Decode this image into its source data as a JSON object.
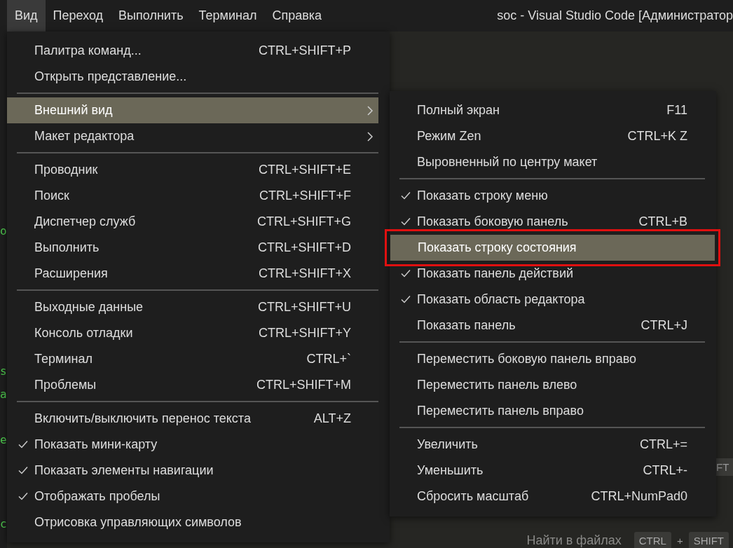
{
  "menubar": {
    "items": [
      {
        "label": "Вид",
        "selected": true
      },
      {
        "label": "Переход",
        "selected": false
      },
      {
        "label": "Выполнить",
        "selected": false
      },
      {
        "label": "Терминал",
        "selected": false
      },
      {
        "label": "Справка",
        "selected": false
      }
    ],
    "title": "soc - Visual Studio Code [Администратор"
  },
  "editor": {
    "code_fragments": [
      "o",
      "s",
      "a",
      "e",
      "c"
    ],
    "partial_key": "FT",
    "hint": {
      "label": "Найти в файлах",
      "keys": [
        {
          "kind": "key",
          "text": "CTRL"
        },
        {
          "kind": "plus",
          "text": "+"
        },
        {
          "kind": "key",
          "text": "SHIFT"
        }
      ]
    }
  },
  "view_menu": {
    "groups": [
      [
        {
          "label": "Палитра команд...",
          "shortcut": "CTRL+SHIFT+P",
          "checked": false,
          "selected": false,
          "submenu": false
        },
        {
          "label": "Открыть представление...",
          "checked": false,
          "selected": false,
          "submenu": false
        }
      ],
      [
        {
          "label": "Внешний вид",
          "checked": false,
          "selected": true,
          "submenu": true
        },
        {
          "label": "Макет редактора",
          "checked": false,
          "selected": false,
          "submenu": true
        }
      ],
      [
        {
          "label": "Проводник",
          "shortcut": "CTRL+SHIFT+E",
          "checked": false,
          "selected": false,
          "submenu": false
        },
        {
          "label": "Поиск",
          "shortcut": "CTRL+SHIFT+F",
          "checked": false,
          "selected": false,
          "submenu": false
        },
        {
          "label": "Диспетчер служб",
          "shortcut": "CTRL+SHIFT+G",
          "checked": false,
          "selected": false,
          "submenu": false
        },
        {
          "label": "Выполнить",
          "shortcut": "CTRL+SHIFT+D",
          "checked": false,
          "selected": false,
          "submenu": false
        },
        {
          "label": "Расширения",
          "shortcut": "CTRL+SHIFT+X",
          "checked": false,
          "selected": false,
          "submenu": false
        }
      ],
      [
        {
          "label": "Выходные данные",
          "shortcut": "CTRL+SHIFT+U",
          "checked": false,
          "selected": false,
          "submenu": false
        },
        {
          "label": "Консоль отладки",
          "shortcut": "CTRL+SHIFT+Y",
          "checked": false,
          "selected": false,
          "submenu": false
        },
        {
          "label": "Терминал",
          "shortcut": "CTRL+`",
          "checked": false,
          "selected": false,
          "submenu": false
        },
        {
          "label": "Проблемы",
          "shortcut": "CTRL+SHIFT+M",
          "checked": false,
          "selected": false,
          "submenu": false
        }
      ],
      [
        {
          "label": "Включить/выключить перенос текста",
          "shortcut": "ALT+Z",
          "checked": false,
          "selected": false,
          "submenu": false
        },
        {
          "label": "Показать мини-карту",
          "checked": true,
          "selected": false,
          "submenu": false
        },
        {
          "label": "Показать элементы навигации",
          "checked": true,
          "selected": false,
          "submenu": false
        },
        {
          "label": "Отображать пробелы",
          "checked": true,
          "selected": false,
          "submenu": false
        },
        {
          "label": "Отрисовка управляющих символов",
          "checked": false,
          "selected": false,
          "submenu": false
        }
      ]
    ]
  },
  "appearance_submenu": {
    "groups": [
      [
        {
          "label": "Полный экран",
          "shortcut": "F11",
          "checked": false,
          "selected": false,
          "submenu": false
        },
        {
          "label": "Режим Zen",
          "shortcut": "CTRL+K Z",
          "checked": false,
          "selected": false,
          "submenu": false
        },
        {
          "label": "Выровненный по центру макет",
          "checked": false,
          "selected": false,
          "submenu": false
        }
      ],
      [
        {
          "label": "Показать строку меню",
          "checked": true,
          "selected": false,
          "submenu": false
        },
        {
          "label": "Показать боковую панель",
          "shortcut": "CTRL+B",
          "checked": true,
          "selected": false,
          "submenu": false
        },
        {
          "label": "Показать строку состояния",
          "checked": false,
          "selected": true,
          "submenu": false,
          "annotated": true
        },
        {
          "label": "Показать панель действий",
          "checked": true,
          "selected": false,
          "submenu": false
        },
        {
          "label": "Показать область редактора",
          "checked": true,
          "selected": false,
          "submenu": false
        },
        {
          "label": "Показать панель",
          "shortcut": "CTRL+J",
          "checked": false,
          "selected": false,
          "submenu": false
        }
      ],
      [
        {
          "label": "Переместить боковую панель вправо",
          "checked": false,
          "selected": false,
          "submenu": false
        },
        {
          "label": "Переместить панель влево",
          "checked": false,
          "selected": false,
          "submenu": false
        },
        {
          "label": "Переместить панель вправо",
          "checked": false,
          "selected": false,
          "submenu": false
        }
      ],
      [
        {
          "label": "Увеличить",
          "shortcut": "CTRL+=",
          "checked": false,
          "selected": false,
          "submenu": false
        },
        {
          "label": "Уменьшить",
          "shortcut": "CTRL+-",
          "checked": false,
          "selected": false,
          "submenu": false
        },
        {
          "label": "Сбросить масштаб",
          "shortcut": "CTRL+NumPad0",
          "checked": false,
          "selected": false,
          "submenu": false
        }
      ]
    ]
  }
}
